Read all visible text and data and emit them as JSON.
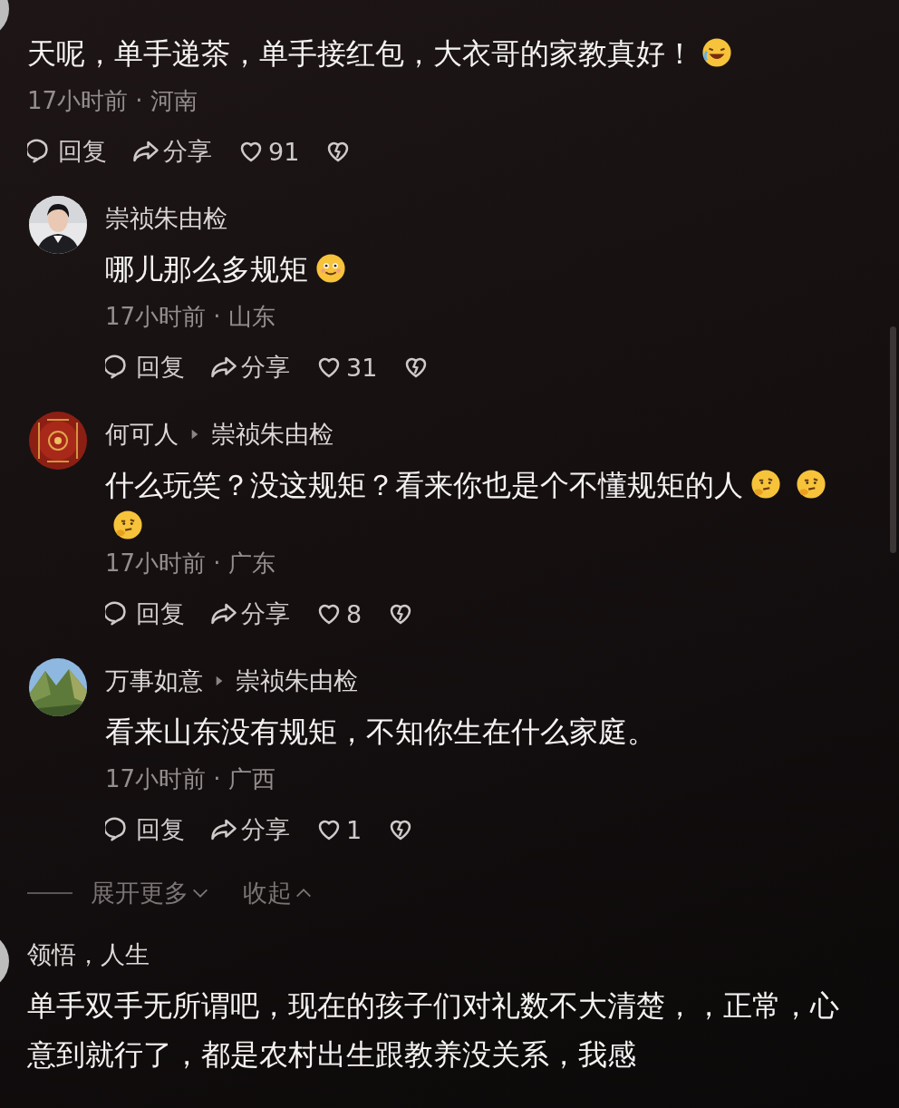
{
  "comments": [
    {
      "avatar": {
        "kind": "picture"
      },
      "segments": [
        {
          "kind": "text",
          "text": "天呢，单手递茶，单手接红包，大衣哥的家教真好！"
        },
        {
          "kind": "emoji"
        }
      ],
      "meta": "17小时前 · 河南",
      "actions": {
        "reply": "回复",
        "share": "分享",
        "likes": "91"
      },
      "replies": [
        {
          "avatar": {
            "kind": "picture"
          },
          "user": "崇祯朱由检",
          "segments": [
            {
              "kind": "text",
              "text": "哪儿那么多规矩"
            },
            {
              "kind": "emoji"
            }
          ],
          "meta": "17小时前 · 山东",
          "actions": {
            "reply": "回复",
            "share": "分享",
            "likes": "31"
          }
        },
        {
          "avatar": {
            "kind": "picture"
          },
          "user": "何可人",
          "reply_to": "崇祯朱由检",
          "segments": [
            {
              "kind": "text",
              "text": "什么玩笑？没这规矩？看来你也是个不懂规矩的人"
            },
            {
              "kind": "emoji"
            },
            {
              "kind": "emoji"
            },
            {
              "kind": "emoji"
            }
          ],
          "meta": "17小时前 · 广东",
          "actions": {
            "reply": "回复",
            "share": "分享",
            "likes": "8"
          }
        },
        {
          "avatar": {
            "kind": "picture"
          },
          "user": "万事如意",
          "reply_to": "崇祯朱由检",
          "segments": [
            {
              "kind": "text",
              "text": "看来山东没有规矩，不知你生在什么家庭。"
            }
          ],
          "meta": "17小时前 · 广西",
          "actions": {
            "reply": "回复",
            "share": "分享",
            "likes": "1"
          }
        }
      ],
      "expand": {
        "more": "展开更多",
        "collapse": "收起"
      }
    },
    {
      "avatar": {
        "kind": "picture"
      },
      "user": "领悟，人生",
      "segments": [
        {
          "kind": "text",
          "text": "单手双手无所谓吧，现在的孩子们对礼数不大清楚，，正常，心意到就行了，都是农村出生跟教养没关系，我感"
        }
      ]
    }
  ]
}
